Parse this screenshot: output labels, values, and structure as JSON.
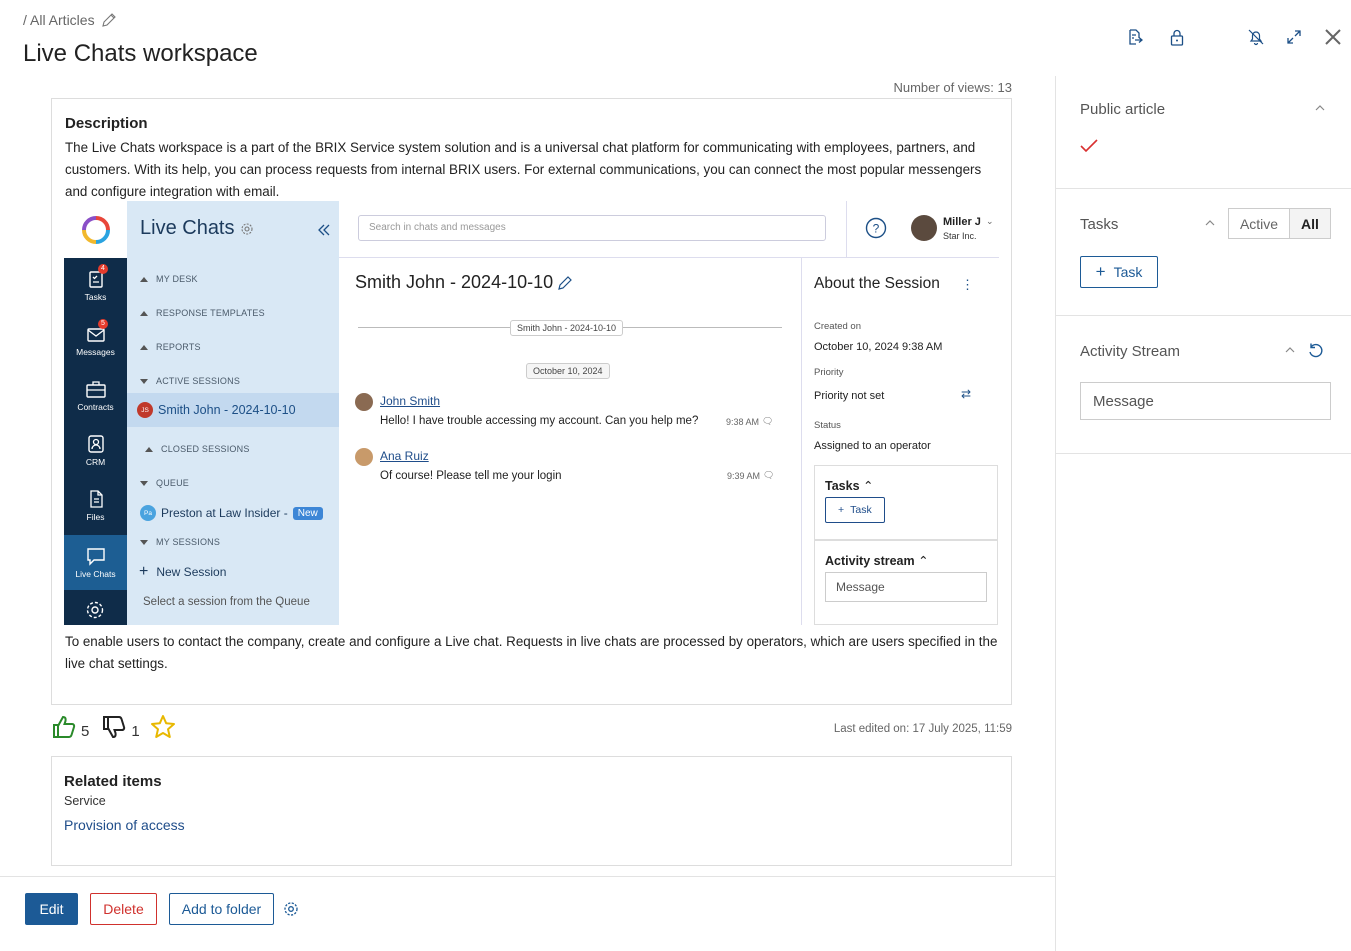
{
  "breadcrumb": "/ All Articles",
  "page_title": "Live Chats workspace",
  "views_label": "Number of views:",
  "views_count": "13",
  "description": {
    "heading": "Description",
    "text": "The Live Chats workspace is a part of the BRIX Service system solution and is a universal chat platform for communicating with employees, partners, and customers. With its help, you can process requests from internal BRIX users. For external communications, you can connect the most popular messengers and configure integration with email.",
    "footer_text": "To enable users to contact the company, create and configure a Live chat. Requests in live chats are processed by operators, which are users specified in the live chat settings."
  },
  "embed": {
    "sidebar": [
      {
        "label": "Tasks",
        "badge": "4",
        "icon": "clipboard-icon"
      },
      {
        "label": "Messages",
        "badge": "5",
        "icon": "envelope-icon"
      },
      {
        "label": "Contracts",
        "badge": "",
        "icon": "briefcase-icon"
      },
      {
        "label": "CRM",
        "badge": "",
        "icon": "contact-card-icon"
      },
      {
        "label": "Files",
        "badge": "",
        "icon": "file-icon"
      },
      {
        "label": "Live Chats",
        "badge": "",
        "icon": "chat-bubble-icon"
      }
    ],
    "nav_title": "Live Chats",
    "sections": {
      "my_desk": "MY DESK",
      "response_templates": "RESPONSE TEMPLATES",
      "reports": "REPORTS",
      "active_sessions": "ACTIVE SESSIONS",
      "closed_sessions": "CLOSED SESSIONS",
      "queue": "QUEUE",
      "my_sessions": "MY SESSIONS"
    },
    "active_session": {
      "initials": "JS",
      "label": "Smith John - 2024-10-10"
    },
    "queue_item": {
      "initials": "Pa",
      "label": "Preston at Law Insider -",
      "badge": "New"
    },
    "new_session": "New Session",
    "select_hint": "Select a session from the Queue",
    "search_placeholder": "Search in chats and messages",
    "user": {
      "name": "Miller J",
      "company": "Star Inc."
    },
    "chat_title": "Smith John - 2024-10-10",
    "chat_divider": "Smith John - 2024-10-10",
    "date_pill": "October 10, 2024",
    "messages": [
      {
        "name": "John Smith",
        "text": "Hello! I have trouble accessing my account. Can you help me?",
        "time": "9:38 AM"
      },
      {
        "name": "Ana Ruiz",
        "text": "Of course! Please tell me your login",
        "time": "9:39 AM"
      }
    ],
    "about": {
      "title": "About the Session",
      "created_label": "Created on",
      "created_value": "October 10, 2024 9:38 AM",
      "priority_label": "Priority",
      "priority_value": "Priority not set",
      "status_label": "Status",
      "status_value": "Assigned to an operator",
      "tasks_label": "Tasks",
      "task_btn": "Task",
      "activity_label": "Activity stream",
      "message_placeholder": "Message"
    }
  },
  "reactions": {
    "likes": "5",
    "dislikes": "1"
  },
  "last_edited": "Last edited on: 17 July 2025, 11:59",
  "related": {
    "heading": "Related items",
    "category": "Service",
    "link": "Provision of access"
  },
  "actions": {
    "edit": "Edit",
    "delete": "Delete",
    "add_to_folder": "Add to folder"
  },
  "right_panel": {
    "public_article": "Public article",
    "tasks": "Tasks",
    "filter_active": "Active",
    "filter_all": "All",
    "task_button": "Task",
    "activity_stream": "Activity Stream",
    "message_placeholder": "Message"
  },
  "colors": {
    "primary": "#1c5a96",
    "link": "#1f4d8a",
    "danger": "#d0312d",
    "like": "#2a8a2a",
    "star": "#e8b800",
    "check": "#d93030"
  }
}
